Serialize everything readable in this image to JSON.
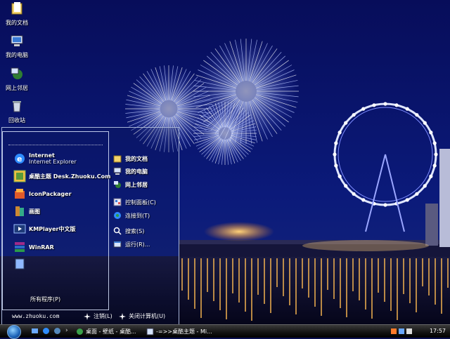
{
  "desktop_icons": [
    {
      "label": "我的文档",
      "icon": "my-documents-icon"
    },
    {
      "label": "我的电脑",
      "icon": "my-computer-icon"
    },
    {
      "label": "网上邻居",
      "icon": "network-icon"
    },
    {
      "label": "回收站",
      "icon": "recycle-bin-icon"
    }
  ],
  "start_menu": {
    "programs": [
      {
        "title": "Internet",
        "sub": "Internet Explorer",
        "icon": "internet-explorer-icon"
      },
      {
        "title": "桌酷主题 Desk.Zhuoku.Com",
        "sub": "",
        "icon": "zhuoku-theme-icon"
      },
      {
        "title": "IconPackager",
        "sub": "",
        "icon": "iconpackager-icon"
      },
      {
        "title": "画图",
        "sub": "",
        "icon": "paint-icon"
      },
      {
        "title": "KMPlayer中文版",
        "sub": "",
        "icon": "kmplayer-icon"
      },
      {
        "title": "WinRAR",
        "sub": "",
        "icon": "winrar-icon"
      }
    ],
    "all_programs": "所有程序(P)",
    "right_items": [
      {
        "label": "我的文档",
        "bold": true,
        "icon": "folder-icon"
      },
      {
        "label": "我的电脑",
        "bold": true,
        "icon": "computer-icon"
      },
      {
        "label": "网上邻居",
        "bold": true,
        "icon": "network-places-icon"
      },
      {
        "label": "控制面板(C)",
        "bold": false,
        "icon": "control-panel-icon"
      },
      {
        "label": "连接到(T)",
        "bold": false,
        "icon": "connect-to-icon"
      },
      {
        "label": "搜索(S)",
        "bold": false,
        "icon": "search-icon"
      },
      {
        "label": "运行(R)...",
        "bold": false,
        "icon": "run-icon"
      }
    ],
    "website": "www.zhuoku.com",
    "logoff": "注销(L)",
    "shutdown": "关闭计算机(U)"
  },
  "taskbar": {
    "tasks": [
      {
        "label": "桌面 - 壁纸 - 桌酷...",
        "icon": "browser-task-icon"
      },
      {
        "label": "-=>>桌酷主题 - Mi...",
        "icon": "document-task-icon"
      }
    ],
    "clock": "17:57"
  },
  "colors": {
    "sky": "#0b1263",
    "taskbar": "#111111",
    "menu_border": "#a8b6d8"
  }
}
